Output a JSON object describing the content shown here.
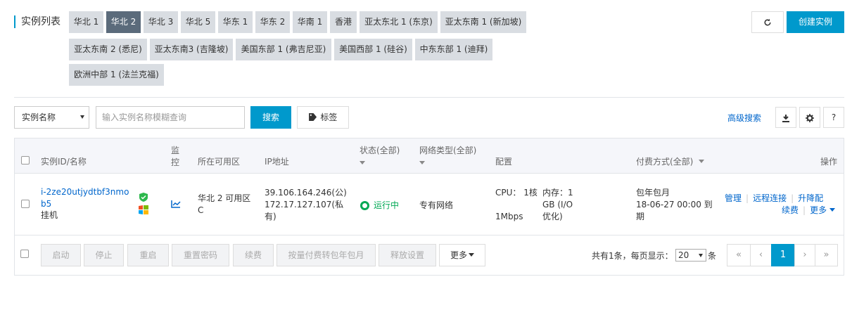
{
  "header": {
    "title": "实例列表",
    "regions": [
      "华北 1",
      "华北 2",
      "华北 3",
      "华北 5",
      "华东 1",
      "华东 2",
      "华南 1",
      "香港",
      "亚太东北 1 (东京)",
      "亚太东南 1 (新加坡)",
      "亚太东南 2 (悉尼)",
      "亚太东南3 (吉隆坡)",
      "美国东部 1 (弗吉尼亚)",
      "美国西部 1 (硅谷)",
      "中东东部 1 (迪拜)",
      "欧洲中部 1 (法兰克福)"
    ],
    "active_region": "华北 2",
    "create_label": "创建实例"
  },
  "search": {
    "field_select": "实例名称",
    "placeholder": "输入实例名称模糊查询",
    "search_label": "搜索",
    "tag_label": "标签",
    "advanced_label": "高级搜索",
    "help_label": "?"
  },
  "table": {
    "headers": {
      "id_name": "实例ID/名称",
      "monitor": "监控",
      "zone": "所在可用区",
      "ip": "IP地址",
      "status": "状态(全部)",
      "network": "网络类型(全部)",
      "config": "配置",
      "billing": "付费方式(全部)",
      "actions": "操作"
    },
    "row": {
      "id": "i-2ze20utjydtbf3nmob5",
      "name": "挂机",
      "zone": "华北 2 可用区 C",
      "public_ip": "39.106.164.246(公)",
      "private_ip": "172.17.127.107(私有)",
      "status": "运行中",
      "network": "专有网络",
      "config_cpu": "CPU： 1核",
      "config_mem": "内存：1 GB (I/O优化)",
      "config_bw": "1Mbps",
      "billing_type": "包年包月",
      "billing_expire": "18-06-27 00:00 到期",
      "actions": {
        "manage": "管理",
        "remote": "远程连接",
        "upgrade": "升降配",
        "renew": "续费",
        "more": "更多"
      }
    }
  },
  "footer": {
    "batch_buttons": [
      "启动",
      "停止",
      "重启",
      "重置密码",
      "续费",
      "按量付费转包年包月",
      "释放设置"
    ],
    "more_label": "更多",
    "total_text": "共有1条，每页显示：",
    "page_size": "20",
    "page_size_unit": "条",
    "pager": [
      "«",
      "‹",
      "1",
      "›",
      "»"
    ],
    "current_page": "1"
  },
  "colors": {
    "accent": "#0099cc",
    "active_tab": "#5b6b7b",
    "tab_bg": "#d9dde2",
    "running": "#00a854"
  }
}
